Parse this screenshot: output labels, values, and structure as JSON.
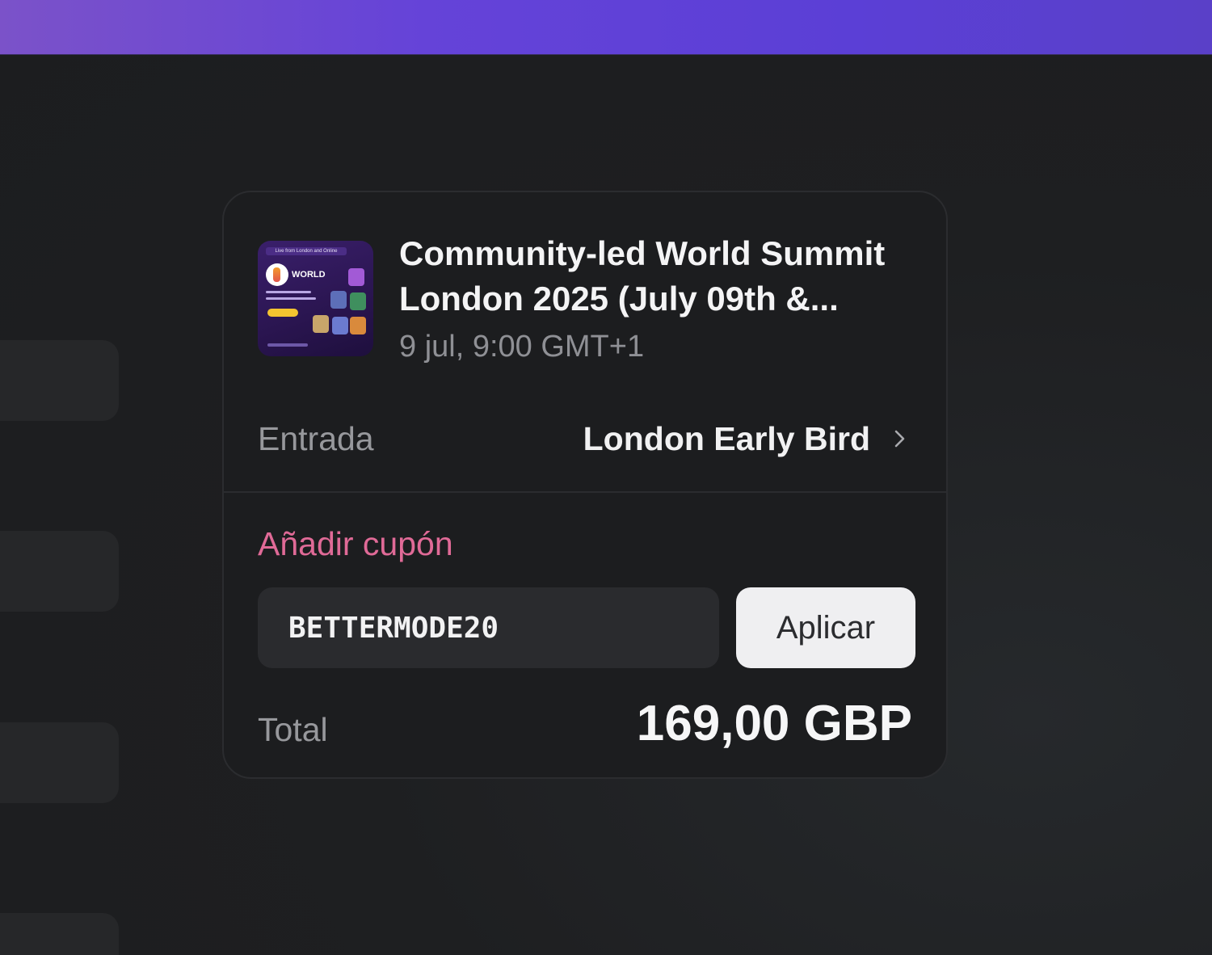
{
  "event": {
    "title": "Community-led World Summit London 2025 (July 09th &...",
    "date": "9 jul, 9:00 GMT+1",
    "thumbnail": {
      "banner": "Live from London and Online",
      "brand": "WORLD"
    }
  },
  "ticket": {
    "label": "Entrada",
    "value": "London Early Bird",
    "icon": "chevron-right-icon"
  },
  "coupon": {
    "link_label": "Añadir cupón",
    "input_value": "BETTERMODE20",
    "apply_label": "Aplicar"
  },
  "total": {
    "label": "Total",
    "value": "169,00 GBP"
  },
  "colors": {
    "accent_link": "#e06a97",
    "header_gradient_start": "#7b52c9",
    "header_gradient_end": "#5a40c8"
  }
}
